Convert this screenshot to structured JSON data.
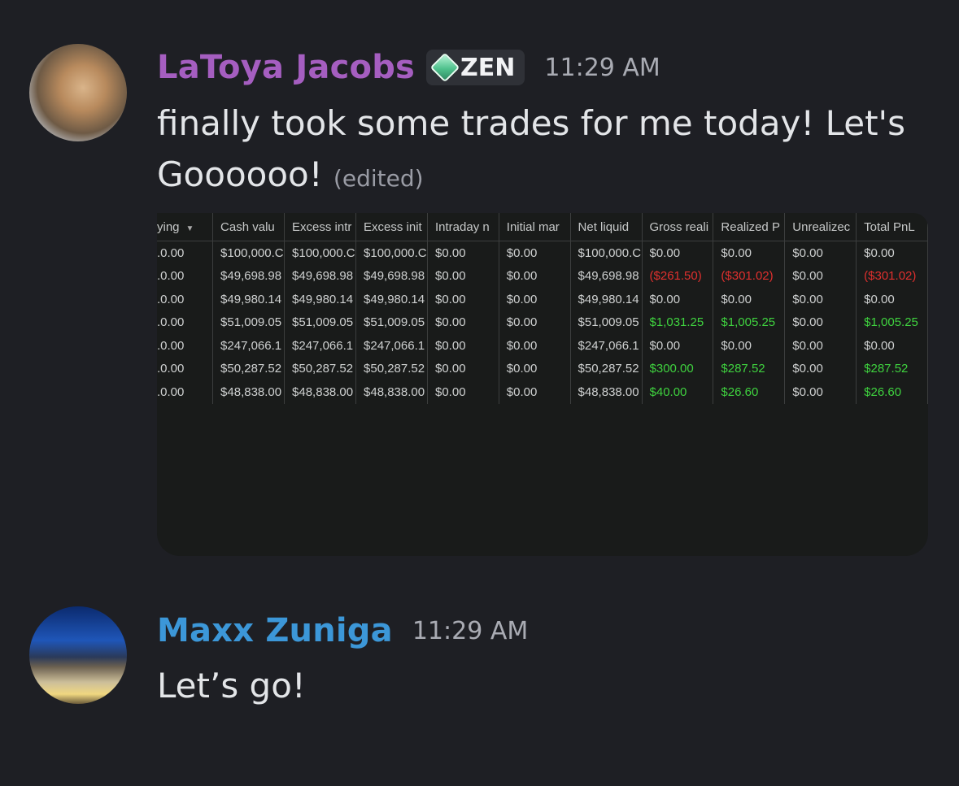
{
  "messages": [
    {
      "avatar": "monkey-avatar",
      "username": "LaToya Jacobs",
      "username_color": "#a55ec0",
      "badge": {
        "icon": "gem-icon",
        "label": "ZEN"
      },
      "timestamp": "11:29 AM",
      "text_line1": "finally took some trades for me today! Let's",
      "text_line2": "Goooooo!",
      "edited": "(edited)"
    },
    {
      "avatar": "boat-avatar",
      "username": "Maxx Zuniga",
      "username_color": "#3c97d8",
      "timestamp": "11:29 AM",
      "text": "Let’s go!"
    }
  ],
  "sheet": {
    "columns": [
      "ying",
      "Cash valu",
      "Excess intr",
      "Excess init",
      "Intraday n",
      "Initial mar",
      "Net liquid",
      "Gross reali",
      "Realized P",
      "Unrealizec",
      "Total PnL"
    ],
    "rows": [
      [
        ".0.00",
        "$100,000.C",
        "$100,000.C",
        "$100,000.C",
        "$0.00",
        "$0.00",
        "$100,000.C",
        "$0.00",
        "$0.00",
        "$0.00",
        "$0.00"
      ],
      [
        ".0.00",
        "$49,698.98",
        "$49,698.98",
        "$49,698.98",
        "$0.00",
        "$0.00",
        "$49,698.98",
        "($261.50)",
        "($301.02)",
        "$0.00",
        "($301.02)"
      ],
      [
        ".0.00",
        "$49,980.14",
        "$49,980.14",
        "$49,980.14",
        "$0.00",
        "$0.00",
        "$49,980.14",
        "$0.00",
        "$0.00",
        "$0.00",
        "$0.00"
      ],
      [
        ".0.00",
        "$51,009.05",
        "$51,009.05",
        "$51,009.05",
        "$0.00",
        "$0.00",
        "$51,009.05",
        "$1,031.25",
        "$1,005.25",
        "$0.00",
        "$1,005.25"
      ],
      [
        ".0.00",
        "$247,066.1",
        "$247,066.1",
        "$247,066.1",
        "$0.00",
        "$0.00",
        "$247,066.1",
        "$0.00",
        "$0.00",
        "$0.00",
        "$0.00"
      ],
      [
        ".0.00",
        "$50,287.52",
        "$50,287.52",
        "$50,287.52",
        "$0.00",
        "$0.00",
        "$50,287.52",
        "$300.00",
        "$287.52",
        "$0.00",
        "$287.52"
      ],
      [
        ".0.00",
        "$48,838.00",
        "$48,838.00",
        "$48,838.00",
        "$0.00",
        "$0.00",
        "$48,838.00",
        "$40.00",
        "$26.60",
        "$0.00",
        "$26.60"
      ]
    ],
    "colors": {
      "negative": "#e0302e",
      "positive": "#3fd23f"
    }
  }
}
